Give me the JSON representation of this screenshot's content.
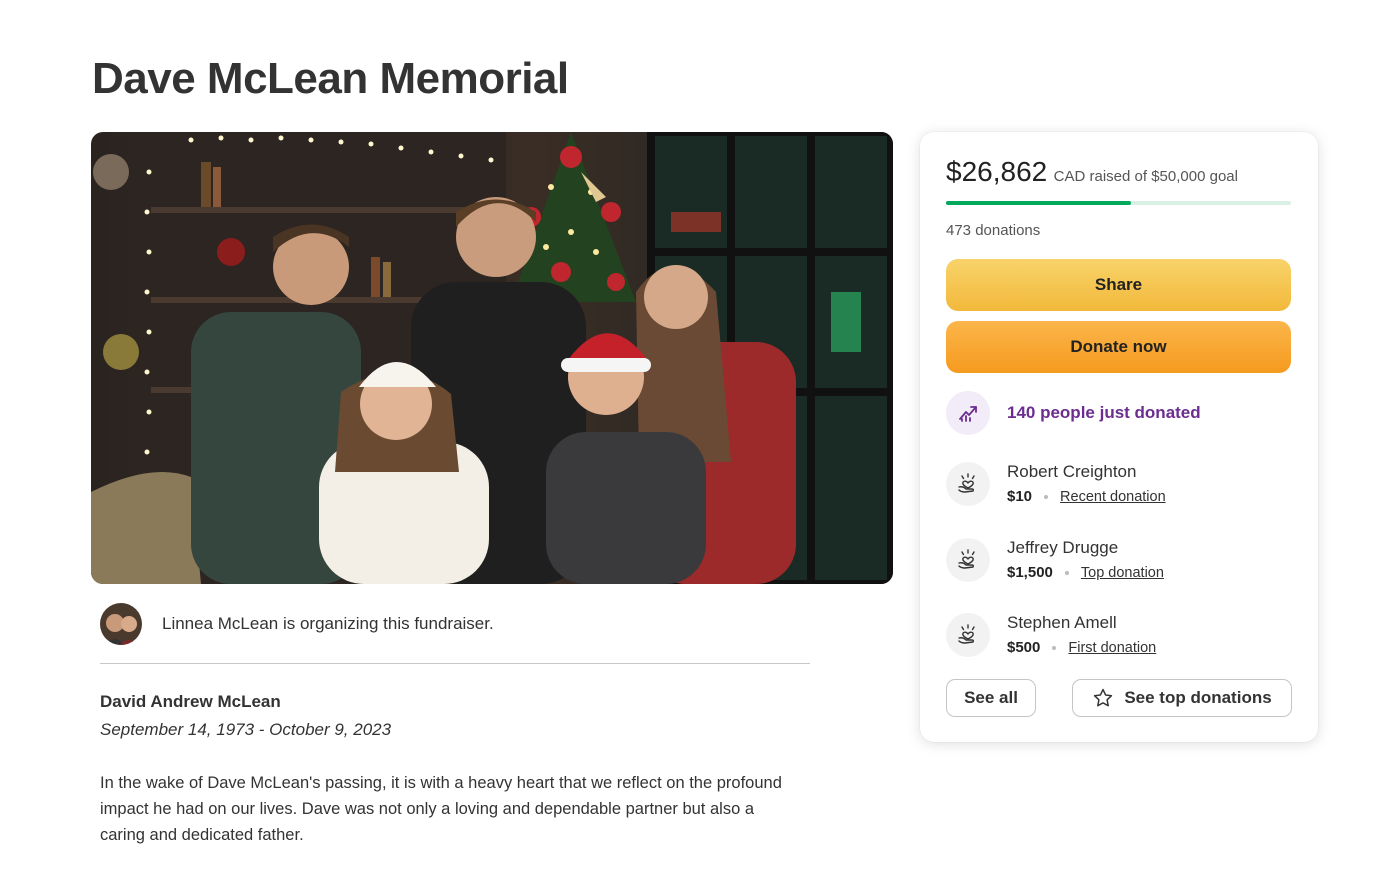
{
  "page": {
    "title": "Dave McLean Memorial"
  },
  "organizer": {
    "text": "Linnea McLean is organizing this fundraiser."
  },
  "story": {
    "name": "David Andrew McLean",
    "dates": "September 14, 1973 - October 9, 2023",
    "paragraph": "In the wake of Dave McLean's passing, it is with a heavy heart that we reflect on the profound impact he had on our lives. Dave was not only a loving and dependable partner but also a caring and dedicated father."
  },
  "donation_card": {
    "amount_raised": "$26,862",
    "goal_text": "CAD raised of $50,000 goal",
    "progress_fraction": 0.537,
    "donations_count": "473 donations",
    "share_label": "Share",
    "donate_label": "Donate now",
    "trend_text": "140 people just donated",
    "donors": [
      {
        "name": "Robert Creighton",
        "amount": "$10",
        "type": "Recent donation"
      },
      {
        "name": "Jeffrey Drugge",
        "amount": "$1,500",
        "type": "Top donation"
      },
      {
        "name": "Stephen Amell",
        "amount": "$500",
        "type": "First donation"
      }
    ],
    "see_all_label": "See all",
    "see_top_label": "See top donations"
  },
  "colors": {
    "progress_fill": "#02a95c",
    "progress_track": "#d9f0e4",
    "share_button": "#f5c34f",
    "donate_button": "#f8a733",
    "trend_text": "#6b2d8f"
  },
  "icons": {
    "trend": "trending-up-icon",
    "donor": "heart-hand-icon",
    "star": "star-icon"
  }
}
